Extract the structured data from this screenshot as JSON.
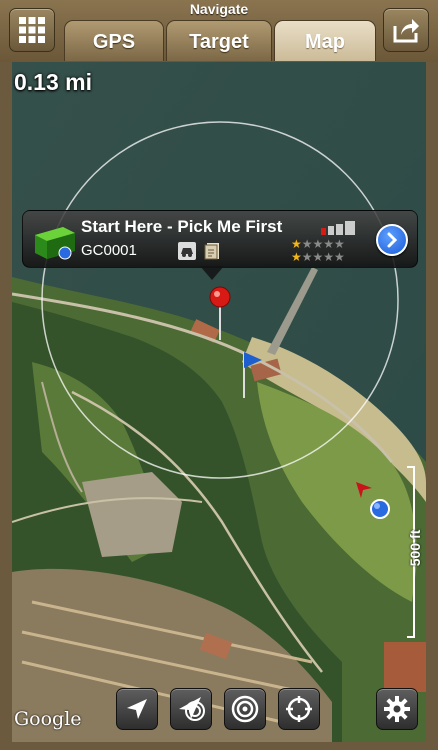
{
  "header": {
    "title": "Navigate",
    "tabs": [
      {
        "label": "GPS",
        "active": false
      },
      {
        "label": "Target",
        "active": false
      },
      {
        "label": "Map",
        "active": true
      }
    ],
    "left_icon": "grid-menu-icon",
    "right_icon": "share-export-icon"
  },
  "map": {
    "distance": "0.13 mi",
    "scale_label": "500 ft",
    "attribution": "Google"
  },
  "callout": {
    "name": "Start Here - Pick Me First",
    "code": "GC0001",
    "difficulty_stars": 1,
    "terrain_stars": 1,
    "max_stars": 5,
    "icon": "cache-container-icon",
    "attribute_icons": [
      "car-icon",
      "document-icon"
    ]
  },
  "toolbar": [
    {
      "name": "navigation-arrow-icon"
    },
    {
      "name": "compass-follow-icon"
    },
    {
      "name": "target-rings-icon"
    },
    {
      "name": "crosshair-icon"
    },
    {
      "name": "settings-gear-icon"
    }
  ],
  "colors": {
    "header_brown": "#7c6846",
    "active_tab": "#d8c9a8",
    "disclosure_blue": "#2a6ae0",
    "pin_red": "#d81a14",
    "star_gold": "#f3b51c"
  }
}
